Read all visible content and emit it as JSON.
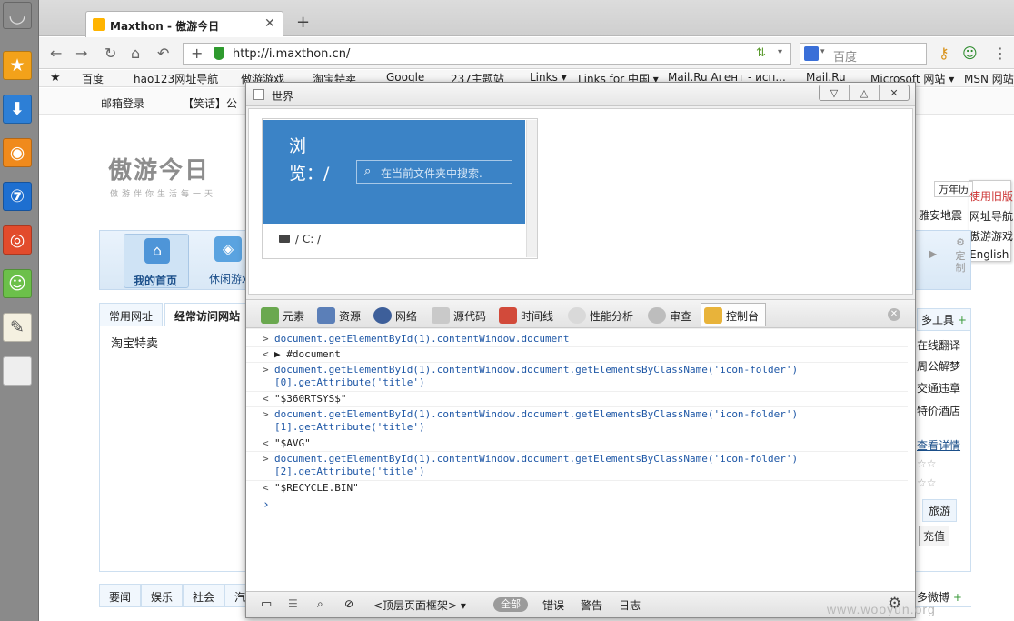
{
  "browser": {
    "tab_title": "Maxthon - 傲游今日",
    "url": "http://i.maxthon.cn/",
    "search_placeholder": "百度",
    "favorites": [
      "百度",
      "hao123网址导航",
      "傲游游戏",
      "淘宝特卖",
      "Google",
      "237主题站",
      "Links ▾",
      "Links for 中国 ▾",
      "Mail.Ru Агент - исп...",
      "Mail.Ru",
      "Microsoft 网站 ▾",
      "MSN 网站"
    ]
  },
  "page": {
    "topline": [
      "邮箱登录",
      "【笑话】公"
    ],
    "logo": "傲游今日",
    "slogan": "傲游伴你生活每一天",
    "nav": {
      "home": "我的首页",
      "games": "休闲游戏",
      "customize": "定制"
    },
    "tabs": [
      "常用网址",
      "经常访问网站"
    ],
    "content_item": "淘宝特卖",
    "bottom_tabs": [
      "要闻",
      "娱乐",
      "社会",
      "汽"
    ],
    "right_menu": [
      "使用旧版",
      "网址导航",
      "傲游游戏",
      "English"
    ],
    "right_col": [
      "万年历",
      "雅安地震",
      "多工具",
      "在线翻译",
      "周公解梦",
      "交通违章",
      "特价酒店",
      "查看详情",
      "旅游",
      "充值",
      "多微博"
    ]
  },
  "devtools": {
    "window_title": "世界",
    "preview": {
      "heading": "浏览：/",
      "search_placeholder": "在当前文件夹中搜索.",
      "path": "/ C: /"
    },
    "tools": [
      "元素",
      "资源",
      "网络",
      "源代码",
      "时间线",
      "性能分析",
      "审查",
      "控制台"
    ],
    "console": [
      {
        "kind": "in",
        "text": "document.getElementById(1).contentWindow.document"
      },
      {
        "kind": "out",
        "text": "▶ #document"
      },
      {
        "kind": "in",
        "text": "document.getElementById(1).contentWindow.document.getElementsByClassName('icon-folder')\n[0].getAttribute('title')"
      },
      {
        "kind": "out",
        "text": "\"$360RTSYS$\""
      },
      {
        "kind": "in",
        "text": "document.getElementById(1).contentWindow.document.getElementsByClassName('icon-folder')\n[1].getAttribute('title')"
      },
      {
        "kind": "out",
        "text": "\"$AVG\""
      },
      {
        "kind": "in",
        "text": "document.getElementById(1).contentWindow.document.getElementsByClassName('icon-folder')\n[2].getAttribute('title')"
      },
      {
        "kind": "out",
        "text": "\"$RECYCLE.BIN\""
      }
    ],
    "status": {
      "frame_select": "<顶层页面框架> ▾",
      "all": "全部",
      "errors": "错误",
      "warnings": "警告",
      "logs": "日志"
    }
  },
  "watermark": "www.wooyun.org",
  "colors": {
    "accent": "#3b83c6",
    "sidebar": "#8a8a8a",
    "console_input": "#1e57a6",
    "console_string": "#c41a16"
  }
}
